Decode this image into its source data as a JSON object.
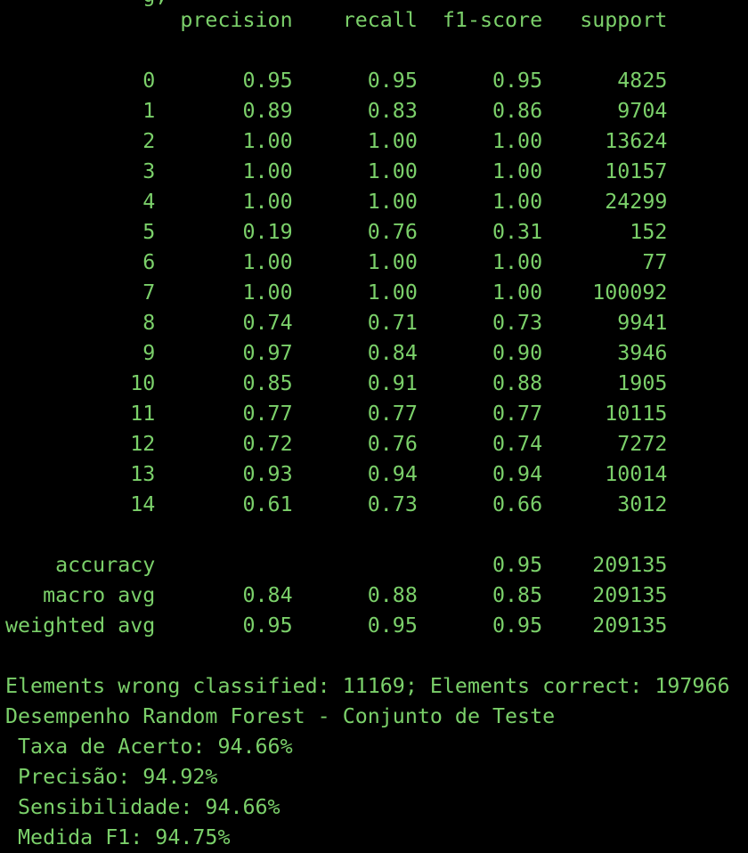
{
  "theme": {
    "background": "#000000",
    "foreground": "#7bd06a"
  },
  "terminal": {
    "clipped_top": "           g,",
    "header": "              precision    recall  f1-score   support",
    "rows": [
      "           0       0.95      0.95      0.95      4825",
      "           1       0.89      0.83      0.86      9704",
      "           2       1.00      1.00      1.00     13624",
      "           3       1.00      1.00      1.00     10157",
      "           4       1.00      1.00      1.00     24299",
      "           5       0.19      0.76      0.31       152",
      "           6       1.00      1.00      1.00        77",
      "           7       1.00      1.00      1.00    100092",
      "           8       0.74      0.71      0.73      9941",
      "           9       0.97      0.84      0.90      3946",
      "          10       0.85      0.91      0.88      1905",
      "          11       0.77      0.77      0.77     10115",
      "          12       0.72      0.76      0.74      7272",
      "          13       0.93      0.94      0.94     10014",
      "          14       0.61      0.73      0.66      3012"
    ],
    "summary": [
      "    accuracy                           0.95    209135",
      "   macro avg       0.84      0.88      0.85    209135",
      "weighted avg       0.95      0.95      0.95    209135"
    ],
    "output": [
      "Elements wrong classified: 11169; Elements correct: 197966",
      "Desempenho Random Forest - Conjunto de Teste",
      " Taxa de Acerto: 94.66%",
      " Precisão: 94.92%",
      " Sensibilidade: 94.66%",
      " Medida F1: 94.75%"
    ]
  }
}
